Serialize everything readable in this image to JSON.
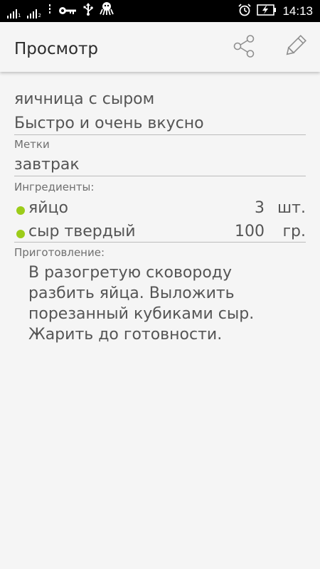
{
  "status_bar": {
    "time": "14:13",
    "sim1_label": "1",
    "sim2_label": "2",
    "icons": [
      "signal-sim1-icon",
      "signal-sim2-icon",
      "data-arrows-icon",
      "key-icon",
      "usb-icon",
      "octopus-icon",
      "alarm-icon",
      "battery-charging-icon"
    ]
  },
  "app_bar": {
    "title": "Просмотр",
    "share_icon": "share-icon",
    "edit_icon": "pencil-icon"
  },
  "recipe": {
    "title": "яичница с сыром",
    "description": "Быстро и очень вкусно",
    "tags_label": "Метки",
    "tags": "завтрак",
    "ingredients_label": "Ингредиенты:",
    "ingredients": [
      {
        "name": "яйцо",
        "quantity": "3",
        "unit": "шт."
      },
      {
        "name": "сыр твердый",
        "quantity": "100",
        "unit": "гр."
      }
    ],
    "preparation_label": "Приготовление:",
    "preparation": "В разогретую сковороду разбить яйца. Выложить порезанный кубиками сыр. Жарить до готовности."
  },
  "colors": {
    "accent_dot": "#9ccc1a",
    "status_bar": "#000000",
    "background": "#f5f5f5"
  }
}
